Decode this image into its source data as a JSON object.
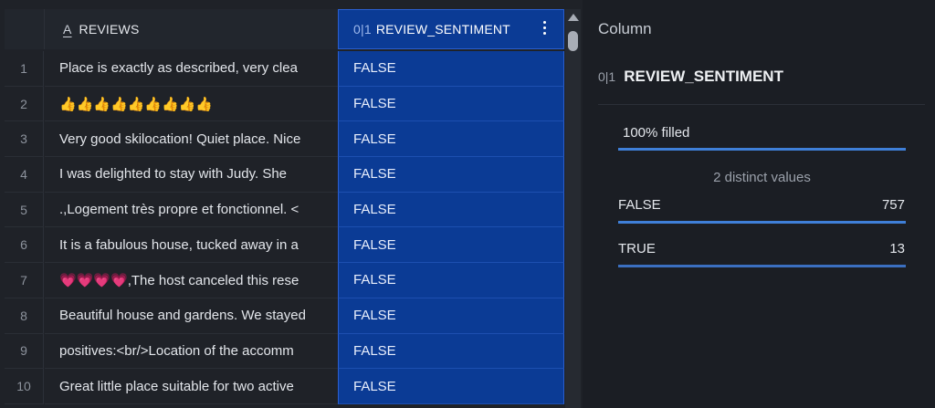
{
  "grid": {
    "columns": {
      "reviews": {
        "type_icon": "A",
        "label": "REVIEWS"
      },
      "sentiment": {
        "type_icon": "0|1",
        "label": "REVIEW_SENTIMENT"
      }
    },
    "rows": [
      {
        "idx": "1",
        "review": "Place is exactly as described, very clea",
        "sentiment": "FALSE"
      },
      {
        "idx": "2",
        "review": "👍👍👍👍👍👍👍👍👍",
        "sentiment": "FALSE"
      },
      {
        "idx": "3",
        "review": "Very good skilocation! Quiet place. Nice",
        "sentiment": "FALSE"
      },
      {
        "idx": "4",
        "review": "I was delighted to stay with Judy.  She",
        "sentiment": "FALSE"
      },
      {
        "idx": "5",
        "review": ".,Logement très propre et fonctionnel. <",
        "sentiment": "FALSE"
      },
      {
        "idx": "6",
        "review": "It is a fabulous house, tucked away in a",
        "sentiment": "FALSE"
      },
      {
        "idx": "7",
        "review": "💗💗💗💗,The host canceled this rese",
        "sentiment": "FALSE"
      },
      {
        "idx": "8",
        "review": "Beautiful house and gardens. We stayed",
        "sentiment": "FALSE"
      },
      {
        "idx": "9",
        "review": "positives:<br/>Location of the accomm",
        "sentiment": "FALSE"
      },
      {
        "idx": "10",
        "review": "Great little place suitable for two active",
        "sentiment": "FALSE"
      }
    ]
  },
  "panel": {
    "title": "Column",
    "column_type_icon": "0|1",
    "column_name": "REVIEW_SENTIMENT",
    "filled_label": "100% filled",
    "distinct_label": "2 distinct values",
    "values": [
      {
        "label": "FALSE",
        "count": "757"
      },
      {
        "label": "TRUE",
        "count": "13"
      }
    ]
  },
  "colors": {
    "selected_column": "#0b3b95",
    "accent_bar": "#3f7fd8",
    "background": "#1b1e24"
  }
}
